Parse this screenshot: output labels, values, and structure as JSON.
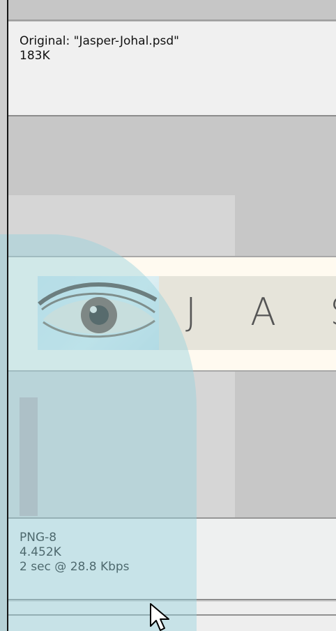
{
  "original": {
    "filename_line": "Original: \"Jasper-Johal.psd\"",
    "size": "183K"
  },
  "preview": {
    "logo_text": "J A S",
    "image_icon": "eye-photo"
  },
  "optimized": {
    "format": "PNG-8",
    "size": "4.452K",
    "download_time": "2 sec @ 28.8 Kbps"
  },
  "colors": {
    "panel_bg": "#f0f0f0",
    "canvas_gray": "#c7c7c7",
    "banner_cream": "#fffaf0",
    "overlay_teal": "#96d2de"
  },
  "cursor_icon": "arrow-cursor-icon"
}
